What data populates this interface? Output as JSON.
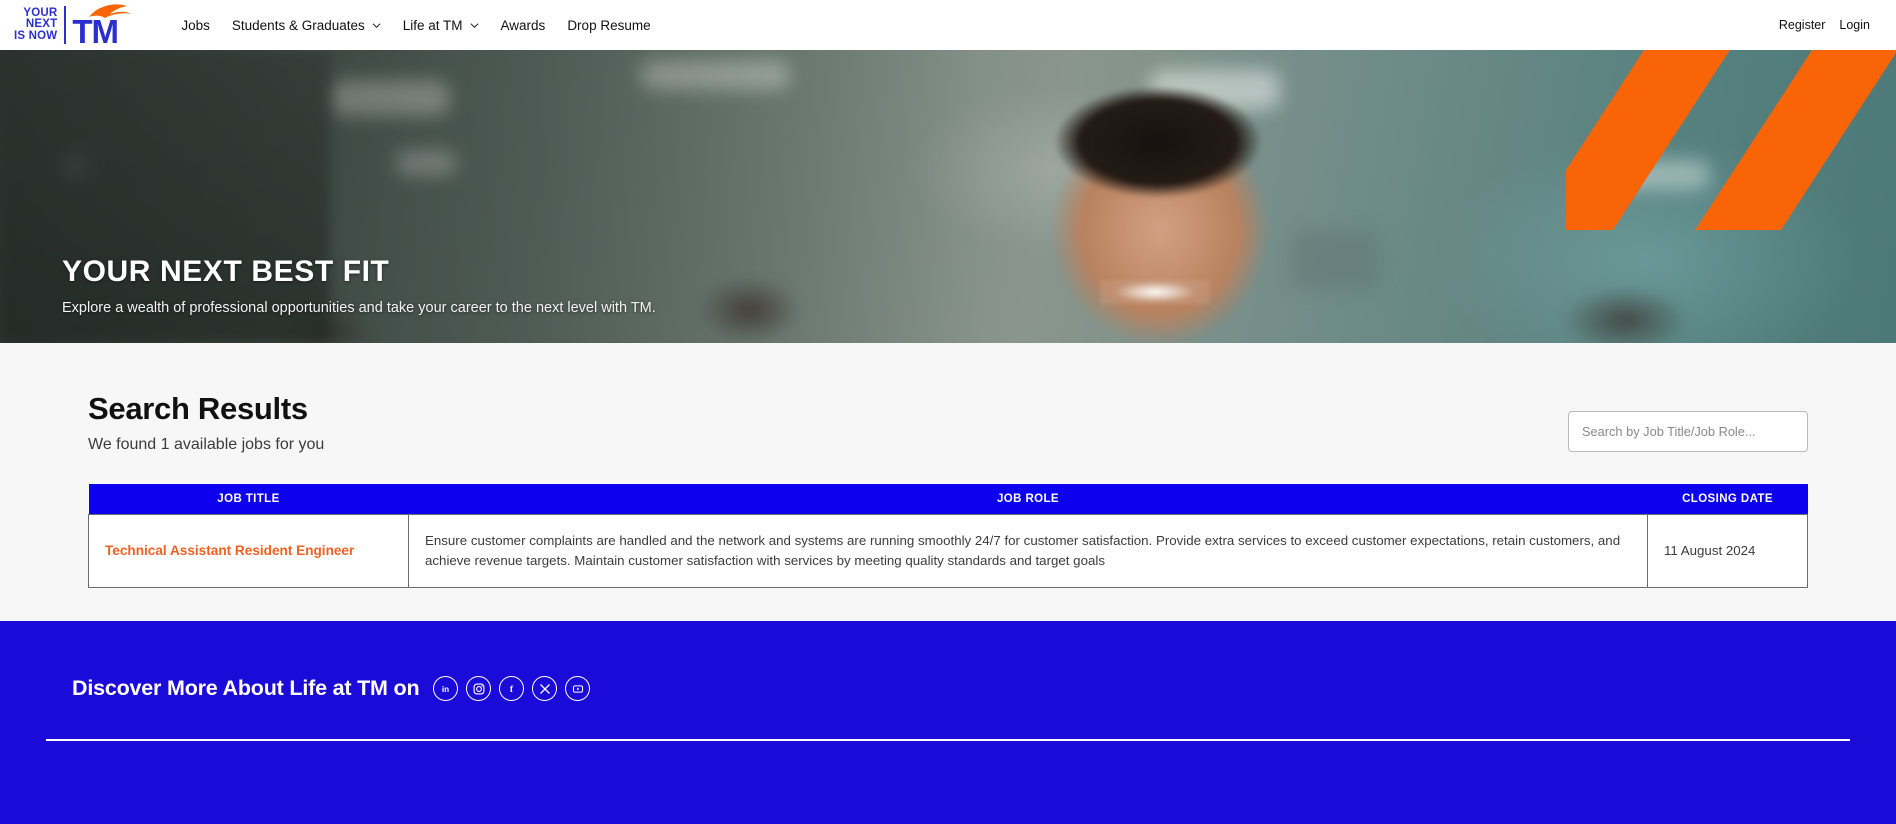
{
  "nav": {
    "logo": {
      "line1": "YOUR",
      "line2": "NEXT",
      "line3": "IS NOW",
      "brand": "TM",
      "swoosh_color": "#f96407",
      "text_color": "#2b2fcf"
    },
    "links": [
      {
        "label": "Jobs",
        "has_dropdown": false
      },
      {
        "label": "Students & Graduates",
        "has_dropdown": true
      },
      {
        "label": "Life at TM",
        "has_dropdown": true
      },
      {
        "label": "Awards",
        "has_dropdown": false
      },
      {
        "label": "Drop Resume",
        "has_dropdown": false
      }
    ],
    "account": [
      {
        "label": "Register"
      },
      {
        "label": "Login"
      }
    ]
  },
  "hero": {
    "title": "YOUR NEXT BEST FIT",
    "subtitle": "Explore a wealth of professional opportunities and take your career to the next level with TM.",
    "stripe_color": "#f96407",
    "stripe_count": 3
  },
  "results": {
    "title": "Search Results",
    "count_text": "We found 1 available jobs for you",
    "search": {
      "placeholder": "Search by Job Title/Job Role...",
      "value": ""
    },
    "table": {
      "header_color": "#0c00ee",
      "columns": [
        "JOB TITLE",
        "JOB ROLE",
        "CLOSING DATE"
      ],
      "rows": [
        {
          "job_title": "Technical Assistant Resident Engineer",
          "job_role": "Ensure customer complaints are handled and the network and systems are running smoothly 24/7 for customer satisfaction. Provide extra services to exceed customer expectations, retain customers, and achieve revenue targets. Maintain customer satisfaction with services by meeting quality standards and target goals",
          "closing_date": "11 August 2024"
        }
      ]
    }
  },
  "footer": {
    "title": "Discover More About Life at TM on",
    "background": "#1a0bd8",
    "socials": [
      {
        "name": "linkedin",
        "glyph": "in"
      },
      {
        "name": "instagram",
        "glyph": ""
      },
      {
        "name": "facebook",
        "glyph": "f"
      },
      {
        "name": "x-twitter",
        "glyph": ""
      },
      {
        "name": "youtube",
        "glyph": ""
      }
    ]
  }
}
